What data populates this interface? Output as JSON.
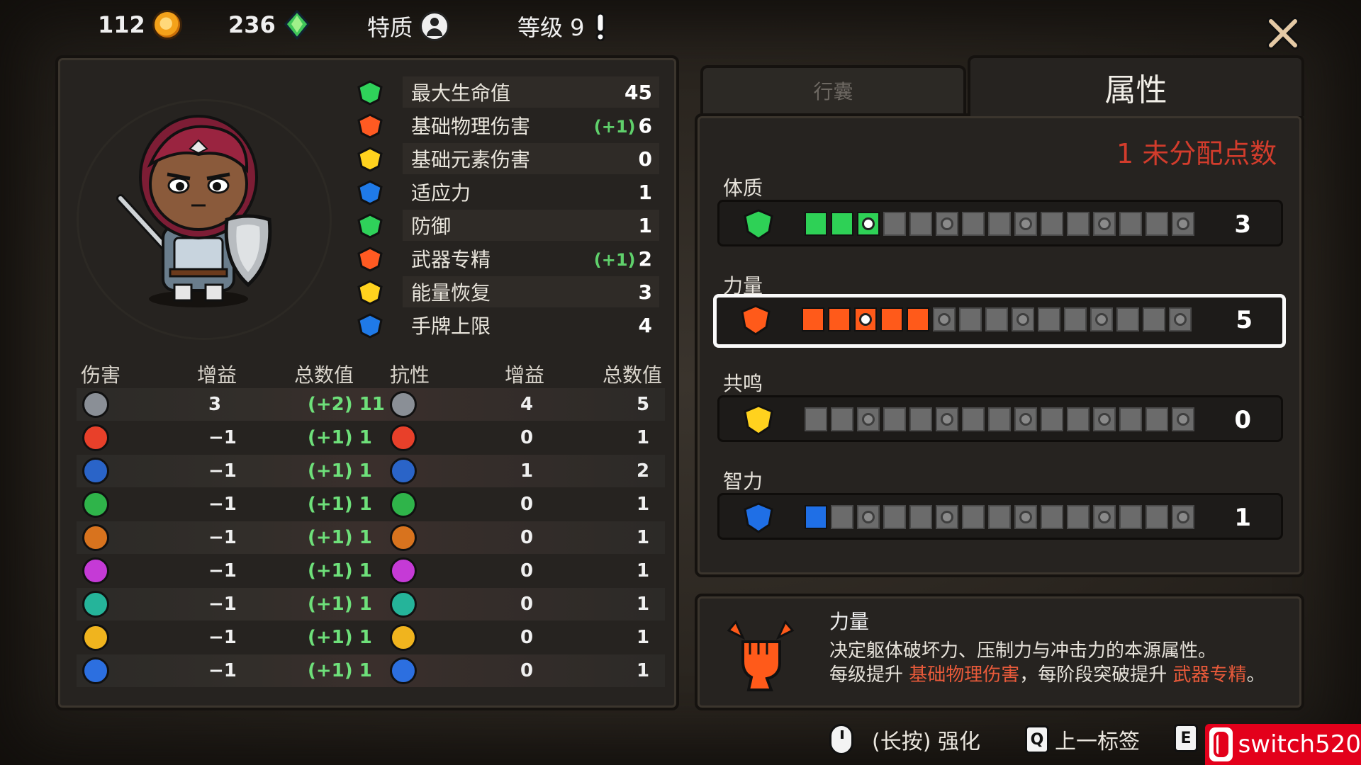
{
  "topbar": {
    "gold": "112",
    "gems": "236",
    "trait_label": "特质",
    "level_label": "等级 9"
  },
  "tabs": {
    "bag": "行囊",
    "attributes": "属性"
  },
  "stats": [
    {
      "label": "最大生命值",
      "bonus": "",
      "value": "45",
      "icon": "heart-icon",
      "color": "#2fd25a"
    },
    {
      "label": "基础物理伤害",
      "bonus": "(+1)",
      "value": "6",
      "icon": "fist-icon",
      "color": "#ff5a22"
    },
    {
      "label": "基础元素伤害",
      "bonus": "",
      "value": "0",
      "icon": "star-burst-icon",
      "color": "#ffd21e"
    },
    {
      "label": "适应力",
      "bonus": "",
      "value": "1",
      "icon": "puzzle-icon",
      "color": "#1f7ae8"
    },
    {
      "label": "防御",
      "bonus": "",
      "value": "1",
      "icon": "shield-icon",
      "color": "#2fd25a"
    },
    {
      "label": "武器专精",
      "bonus": "(+1)",
      "value": "2",
      "icon": "weapon-mastery-icon",
      "color": "#ff5a22"
    },
    {
      "label": "能量恢复",
      "bonus": "",
      "value": "3",
      "icon": "energy-star-icon",
      "color": "#ffd21e"
    },
    {
      "label": "手牌上限",
      "bonus": "",
      "value": "4",
      "icon": "cards-icon",
      "color": "#1f7ae8"
    }
  ],
  "table": {
    "headers": {
      "damage": "伤害",
      "gain1": "增益",
      "total1": "总数值",
      "resist": "抗性",
      "gain2": "增益",
      "total2": "总数值"
    },
    "rows": [
      {
        "icon": "sword-icon",
        "color": "#8a8f96",
        "dgain": "3",
        "dtotal": "(+2) 11",
        "rgain": "4",
        "rtotal": "5"
      },
      {
        "icon": "fire-icon",
        "color": "#e8402a",
        "dgain": "−1",
        "dtotal": "(+1) 1",
        "rgain": "0",
        "rtotal": "1"
      },
      {
        "icon": "frost-icon",
        "color": "#2a64c8",
        "dgain": "−1",
        "dtotal": "(+1) 1",
        "rgain": "1",
        "rtotal": "2"
      },
      {
        "icon": "poison-icon",
        "color": "#2fb44a",
        "dgain": "−1",
        "dtotal": "(+1) 1",
        "rgain": "0",
        "rtotal": "1"
      },
      {
        "icon": "earth-icon",
        "color": "#d8731e",
        "dgain": "−1",
        "dtotal": "(+1) 1",
        "rgain": "0",
        "rtotal": "1"
      },
      {
        "icon": "arcane-icon",
        "color": "#c53ad6",
        "dgain": "−1",
        "dtotal": "(+1) 1",
        "rgain": "0",
        "rtotal": "1"
      },
      {
        "icon": "wind-icon",
        "color": "#25b49a",
        "dgain": "−1",
        "dtotal": "(+1) 1",
        "rgain": "0",
        "rtotal": "1"
      },
      {
        "icon": "lightning-icon",
        "color": "#f0b41e",
        "dgain": "−1",
        "dtotal": "(+1) 1",
        "rgain": "0",
        "rtotal": "1"
      },
      {
        "icon": "water-icon",
        "color": "#2c6fe0",
        "dgain": "−1",
        "dtotal": "(+1) 1",
        "rgain": "0",
        "rtotal": "1"
      }
    ]
  },
  "attributes": {
    "unallocated": "1 未分配点数",
    "items": [
      {
        "label": "体质",
        "value": "3",
        "filled": 3,
        "color": "#2ed156",
        "icon": "constitution-shield-icon",
        "selected": false
      },
      {
        "label": "力量",
        "value": "5",
        "filled": 5,
        "color": "#ff5a1a",
        "icon": "strength-fist-icon",
        "selected": true
      },
      {
        "label": "共鸣",
        "value": "0",
        "filled": 0,
        "color": "#ffd21e",
        "icon": "resonance-icon",
        "selected": false
      },
      {
        "label": "智力",
        "value": "1",
        "filled": 1,
        "color": "#1f6fe6",
        "icon": "intellect-book-icon",
        "selected": false
      }
    ]
  },
  "description": {
    "title": "力量",
    "line1": "决定躯体破坏力、压制力与冲击力的本源属性。",
    "line2_a": "每级提升 ",
    "line2_b": "基础物理伤害",
    "line2_c": "，每阶段突破提升 ",
    "line2_d": "武器专精",
    "line2_e": "。"
  },
  "hints": {
    "hold": "(长按) 强化",
    "prev_key": "Q",
    "prev": "上一标签",
    "next_key": "E"
  },
  "watermark": "switch520"
}
